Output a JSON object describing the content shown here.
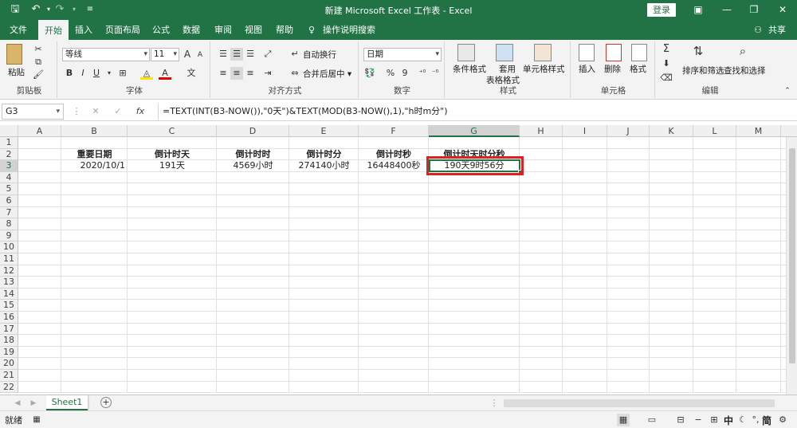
{
  "window": {
    "title": "新建 Microsoft Excel 工作表 - Excel",
    "login": "登录",
    "minimize_glyph": "—",
    "restore_glyph": "❐",
    "close_glyph": "✕",
    "save_glyph": "🖫",
    "undo_glyph": "↶",
    "redo_glyph": "↷"
  },
  "tabs": [
    "文件",
    "开始",
    "插入",
    "页面布局",
    "公式",
    "数据",
    "审阅",
    "视图",
    "帮助",
    "操作说明搜索"
  ],
  "share": "共享",
  "ribbon": {
    "clipboard": {
      "paste": "粘贴",
      "label": "剪贴板"
    },
    "font": {
      "name": "等线",
      "size": "11",
      "bold": "B",
      "italic": "I",
      "underline": "U",
      "grow": "A",
      "shrink": "A",
      "wen": "文",
      "label": "字体"
    },
    "alignment": {
      "wrap": "自动换行",
      "merge": "合并后居中",
      "label": "对齐方式"
    },
    "number": {
      "format": "日期",
      "percent": "%",
      "comma": "9",
      "inc": "⁺⁰",
      "dec": "⁻⁰",
      "label": "数字"
    },
    "styles": {
      "conditional": "条件格式",
      "table": "套用",
      "table2": "表格格式",
      "cell": "单元格样式",
      "label": "样式"
    },
    "cells": {
      "insert": "插入",
      "delete": "删除",
      "format": "格式",
      "label": "单元格"
    },
    "editing": {
      "sum": "Σ",
      "sort": "排序和筛选",
      "find": "查找和选择",
      "label": "编辑"
    }
  },
  "formula_bar": {
    "name_box": "G3",
    "fx": "fx",
    "cancel": "✕",
    "confirm": "✓",
    "formula": "=TEXT(INT(B3-NOW()),\"0天\")&TEXT(MOD(B3-NOW(),1),\"h时m分\")"
  },
  "columns": [
    "A",
    "B",
    "C",
    "D",
    "E",
    "F",
    "G",
    "H",
    "I",
    "J",
    "K",
    "L",
    "M"
  ],
  "rows": [
    "1",
    "2",
    "3",
    "4",
    "5",
    "6",
    "7",
    "8",
    "9",
    "10",
    "11",
    "12",
    "13",
    "14",
    "15",
    "16",
    "17",
    "18",
    "19",
    "20",
    "21",
    "22"
  ],
  "cells": {
    "B2": "重要日期",
    "C2": "倒计时天",
    "D2": "倒计时时",
    "E2": "倒计时分",
    "F2": "倒计时秒",
    "G2": "倒计时天时分秒",
    "B3": "2020/10/1",
    "C3": "191天",
    "D3": "4569小时",
    "E3": "274140小时",
    "F3": "16448400秒",
    "G3": "190天9时56分"
  },
  "sheet_tab": "Sheet1",
  "status": {
    "ready": "就绪",
    "ime": "中",
    "ime2": "简"
  },
  "colors": {
    "excel_green": "#217346",
    "highlight_red": "#e02020"
  }
}
